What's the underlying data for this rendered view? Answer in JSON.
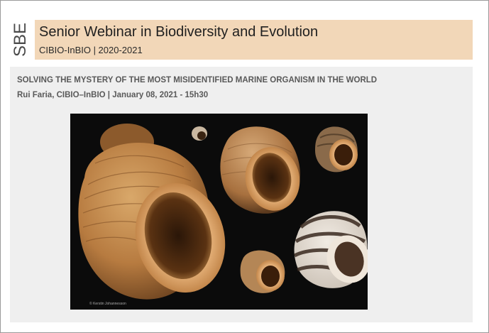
{
  "header": {
    "logo": "SBE",
    "title": "Senior Webinar in Biodiversity and Evolution",
    "subtitle": "CIBIO-InBIO | 2020-2021"
  },
  "talk": {
    "title": "SOLVING THE MYSTERY OF THE MOST MISIDENTIFIED MARINE ORGANISM IN THE WORLD",
    "meta": "Rui Faria,  CIBIO–InBIO | January  08, 2021 - 15h30"
  },
  "photo": {
    "subject": "sea snail shells",
    "credit": "© Kerstin Johannesson"
  },
  "colors": {
    "title_bar": "#f2d7b8",
    "content_bg": "#efefef",
    "photo_bg": "#0b0b0b"
  }
}
